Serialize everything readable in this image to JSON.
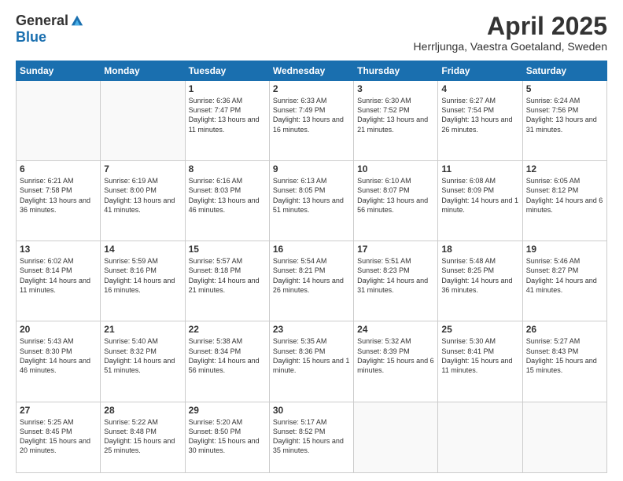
{
  "logo": {
    "general": "General",
    "blue": "Blue"
  },
  "title": "April 2025",
  "location": "Herrljunga, Vaestra Goetaland, Sweden",
  "days_of_week": [
    "Sunday",
    "Monday",
    "Tuesday",
    "Wednesday",
    "Thursday",
    "Friday",
    "Saturday"
  ],
  "weeks": [
    [
      {
        "day": "",
        "info": ""
      },
      {
        "day": "",
        "info": ""
      },
      {
        "day": "1",
        "info": "Sunrise: 6:36 AM\nSunset: 7:47 PM\nDaylight: 13 hours and 11 minutes."
      },
      {
        "day": "2",
        "info": "Sunrise: 6:33 AM\nSunset: 7:49 PM\nDaylight: 13 hours and 16 minutes."
      },
      {
        "day": "3",
        "info": "Sunrise: 6:30 AM\nSunset: 7:52 PM\nDaylight: 13 hours and 21 minutes."
      },
      {
        "day": "4",
        "info": "Sunrise: 6:27 AM\nSunset: 7:54 PM\nDaylight: 13 hours and 26 minutes."
      },
      {
        "day": "5",
        "info": "Sunrise: 6:24 AM\nSunset: 7:56 PM\nDaylight: 13 hours and 31 minutes."
      }
    ],
    [
      {
        "day": "6",
        "info": "Sunrise: 6:21 AM\nSunset: 7:58 PM\nDaylight: 13 hours and 36 minutes."
      },
      {
        "day": "7",
        "info": "Sunrise: 6:19 AM\nSunset: 8:00 PM\nDaylight: 13 hours and 41 minutes."
      },
      {
        "day": "8",
        "info": "Sunrise: 6:16 AM\nSunset: 8:03 PM\nDaylight: 13 hours and 46 minutes."
      },
      {
        "day": "9",
        "info": "Sunrise: 6:13 AM\nSunset: 8:05 PM\nDaylight: 13 hours and 51 minutes."
      },
      {
        "day": "10",
        "info": "Sunrise: 6:10 AM\nSunset: 8:07 PM\nDaylight: 13 hours and 56 minutes."
      },
      {
        "day": "11",
        "info": "Sunrise: 6:08 AM\nSunset: 8:09 PM\nDaylight: 14 hours and 1 minute."
      },
      {
        "day": "12",
        "info": "Sunrise: 6:05 AM\nSunset: 8:12 PM\nDaylight: 14 hours and 6 minutes."
      }
    ],
    [
      {
        "day": "13",
        "info": "Sunrise: 6:02 AM\nSunset: 8:14 PM\nDaylight: 14 hours and 11 minutes."
      },
      {
        "day": "14",
        "info": "Sunrise: 5:59 AM\nSunset: 8:16 PM\nDaylight: 14 hours and 16 minutes."
      },
      {
        "day": "15",
        "info": "Sunrise: 5:57 AM\nSunset: 8:18 PM\nDaylight: 14 hours and 21 minutes."
      },
      {
        "day": "16",
        "info": "Sunrise: 5:54 AM\nSunset: 8:21 PM\nDaylight: 14 hours and 26 minutes."
      },
      {
        "day": "17",
        "info": "Sunrise: 5:51 AM\nSunset: 8:23 PM\nDaylight: 14 hours and 31 minutes."
      },
      {
        "day": "18",
        "info": "Sunrise: 5:48 AM\nSunset: 8:25 PM\nDaylight: 14 hours and 36 minutes."
      },
      {
        "day": "19",
        "info": "Sunrise: 5:46 AM\nSunset: 8:27 PM\nDaylight: 14 hours and 41 minutes."
      }
    ],
    [
      {
        "day": "20",
        "info": "Sunrise: 5:43 AM\nSunset: 8:30 PM\nDaylight: 14 hours and 46 minutes."
      },
      {
        "day": "21",
        "info": "Sunrise: 5:40 AM\nSunset: 8:32 PM\nDaylight: 14 hours and 51 minutes."
      },
      {
        "day": "22",
        "info": "Sunrise: 5:38 AM\nSunset: 8:34 PM\nDaylight: 14 hours and 56 minutes."
      },
      {
        "day": "23",
        "info": "Sunrise: 5:35 AM\nSunset: 8:36 PM\nDaylight: 15 hours and 1 minute."
      },
      {
        "day": "24",
        "info": "Sunrise: 5:32 AM\nSunset: 8:39 PM\nDaylight: 15 hours and 6 minutes."
      },
      {
        "day": "25",
        "info": "Sunrise: 5:30 AM\nSunset: 8:41 PM\nDaylight: 15 hours and 11 minutes."
      },
      {
        "day": "26",
        "info": "Sunrise: 5:27 AM\nSunset: 8:43 PM\nDaylight: 15 hours and 15 minutes."
      }
    ],
    [
      {
        "day": "27",
        "info": "Sunrise: 5:25 AM\nSunset: 8:45 PM\nDaylight: 15 hours and 20 minutes."
      },
      {
        "day": "28",
        "info": "Sunrise: 5:22 AM\nSunset: 8:48 PM\nDaylight: 15 hours and 25 minutes."
      },
      {
        "day": "29",
        "info": "Sunrise: 5:20 AM\nSunset: 8:50 PM\nDaylight: 15 hours and 30 minutes."
      },
      {
        "day": "30",
        "info": "Sunrise: 5:17 AM\nSunset: 8:52 PM\nDaylight: 15 hours and 35 minutes."
      },
      {
        "day": "",
        "info": ""
      },
      {
        "day": "",
        "info": ""
      },
      {
        "day": "",
        "info": ""
      }
    ]
  ]
}
